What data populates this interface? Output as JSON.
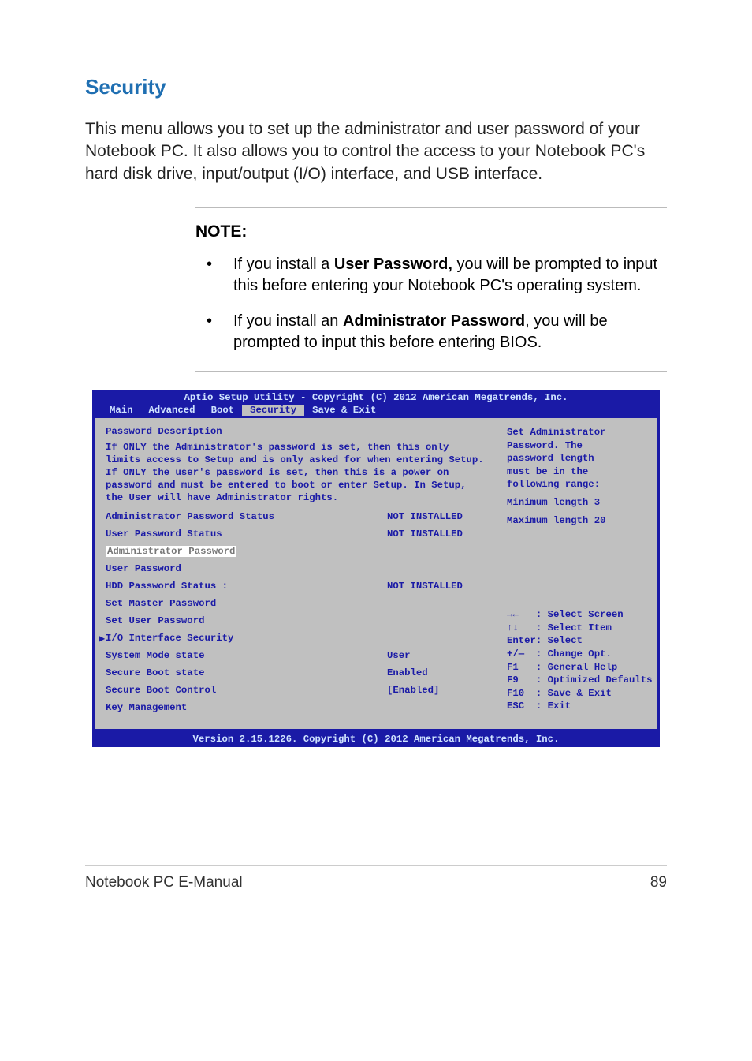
{
  "heading": "Security",
  "intro": "This menu allows you to set up the administrator and user password of your Notebook PC. It also allows you to control the access to your Notebook PC's hard disk drive, input/output (I/O) interface, and USB interface.",
  "note": {
    "title": "NOTE:",
    "items": [
      {
        "pre": "If you install a ",
        "bold": "User Password,",
        "post": " you will be prompted to input this before entering your Notebook PC's operating system."
      },
      {
        "pre": "If you install an ",
        "bold": "Administrator Password",
        "post": ", you will be prompted to input this before entering BIOS."
      }
    ]
  },
  "bios": {
    "topbar": "Aptio Setup Utility - Copyright (C) 2012 American Megatrends, Inc.",
    "tabs": [
      "Main",
      "Advanced",
      "Boot",
      "Security",
      "Save & Exit"
    ],
    "active_tab": "Security",
    "left": {
      "title": "Password Description",
      "desc": "If ONLY the Administrator's password is set, then this only limits access to Setup and is only asked for when entering Setup. If ONLY the user's password is set, then this is a power on password and must be entered to boot or enter Setup. In Setup, the User will have Administrator rights.",
      "rows": [
        {
          "label": "Administrator Password Status",
          "value": "NOT INSTALLED"
        },
        {
          "label": "User Password Status",
          "value": "NOT INSTALLED"
        }
      ],
      "admin_pw": "Administrator Password",
      "user_pw": "User Password",
      "hdd_row": {
        "label": "HDD Password Status :",
        "value": "NOT INSTALLED"
      },
      "set_master": "Set Master Password",
      "set_user": "Set User Password",
      "io_sec": "I/O Interface Security",
      "sys_mode": {
        "label": "System Mode state",
        "value": "User"
      },
      "sb_state": {
        "label": "Secure Boot state",
        "value": "Enabled"
      },
      "sb_ctrl": {
        "label": "Secure Boot Control",
        "value": "[Enabled]"
      },
      "key_mgmt": "Key Management"
    },
    "right": {
      "help_lines": [
        "Set Administrator",
        "Password. The",
        "password length",
        "must be in the",
        "following range:",
        "Minimum length 3",
        "Maximum length 20"
      ],
      "keys": [
        "→←   : Select Screen",
        "↑↓   : Select Item",
        "Enter: Select",
        "+/—  : Change Opt.",
        "F1   : General Help",
        "F9   : Optimized Defaults",
        "F10  : Save & Exit",
        "ESC  : Exit"
      ]
    },
    "bottombar": "Version 2.15.1226. Copyright (C) 2012 American Megatrends, Inc."
  },
  "footer": {
    "left": "Notebook PC E-Manual",
    "right": "89"
  }
}
